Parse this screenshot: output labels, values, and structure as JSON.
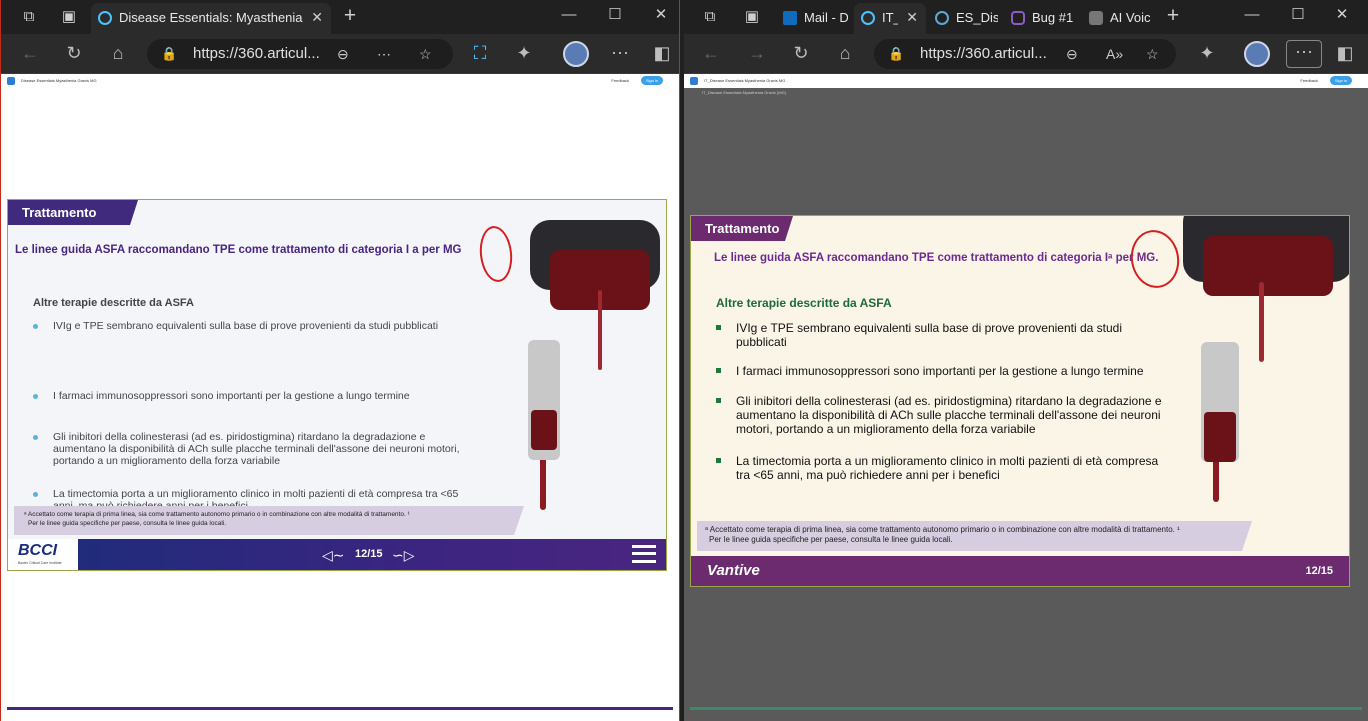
{
  "left_window": {
    "tab_title": "Disease Essentials: Myasthenia Gr",
    "url": "https://360.articul...",
    "page_header": {
      "title": "Disease Essentials Myasthenia Gravis MG",
      "feedback": "Feedback",
      "signin": "Sign in"
    },
    "slide": {
      "section": "Trattamento",
      "headline": "Le linee guida ASFA raccomandano TPE come trattamento di categoria I a per MG",
      "subheading": "Altre terapie descritte da ASFA",
      "bullets": [
        "IVIg e TPE sembrano equivalenti sulla base di prove provenienti da studi pubblicati",
        "I farmaci immunosoppressori sono importanti per la gestione a lungo termine",
        "Gli inibitori della colinesterasi (ad es. piridostigmina) ritardano la degradazione e aumentano la disponibilità di ACh sulle placche terminali dell'assone dei neuroni motori, portando a un miglioramento della forza variabile",
        "La timectomia porta a un miglioramento clinico in molti pazienti di età compresa tra <65 anni, ma può richiedere anni per i benefici"
      ],
      "footnote_1": "ᵃ Accettato come terapia di prima linea, sia come trattamento autonomo primario o in combinazione con altre modalità di trattamento. ¹",
      "footnote_2": "Per le linee guida specifiche per paese, consulta le linee guida locali.",
      "logo": "BCCI",
      "logo_sub": "Baxter Critical Care Institute",
      "page_counter": "12/15"
    }
  },
  "right_window": {
    "tabs": [
      {
        "title": "Mail - D",
        "icon": "outlook-icon"
      },
      {
        "title": "IT_",
        "icon": "edge-icon"
      },
      {
        "title": "ES_Dise",
        "icon": "edge-icon"
      },
      {
        "title": "Bug #1",
        "icon": "devops-icon"
      },
      {
        "title": "AI Voic",
        "icon": "pause-icon"
      }
    ],
    "url": "https://360.articul...",
    "page_header": {
      "title": "IT_Disease Essentials Myasthenia Gravis MG",
      "feedback": "Feedback",
      "signin": "Sign in"
    },
    "breadcrumb": "IT_Disease Essentials Myasthenia Gravis (MG)",
    "slide": {
      "section": "Trattamento",
      "headline": "Le linee guida ASFA raccomandano TPE come trattamento di categoria Iᵃ per MG.",
      "subheading": "Altre terapie descritte da ASFA",
      "bullets": [
        "IVIg e TPE sembrano equivalenti sulla base di prove provenienti da studi pubblicati",
        "I farmaci immunosoppressori sono importanti per la gestione a lungo termine",
        "Gli inibitori della colinesterasi (ad es. piridostigmina) ritardano la degradazione e aumentano la disponibilità di ACh sulle placche terminali dell'assone dei neuroni motori, portando a un miglioramento della forza variabile",
        "La timectomia porta a un miglioramento clinico in molti pazienti di età compresa tra <65 anni, ma può richiedere anni per i benefici"
      ],
      "footnote_1": "ᵃ Accettato come terapia di prima linea, sia come trattamento autonomo primario o in combinazione con altre modalità di trattamento. ¹",
      "footnote_2": "Per le linee guida specifiche per paese, consulta le linee guida locali.",
      "logo": "Vantive",
      "page_counter": "12/15"
    }
  },
  "colors": {
    "purple": "#4a2580",
    "green_bullet": "#1f7a3a",
    "annotation_red": "#d21f1f"
  }
}
